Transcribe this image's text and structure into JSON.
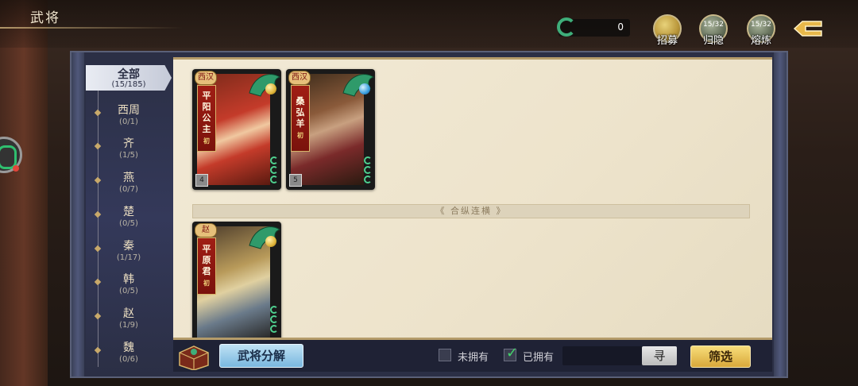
{
  "header": {
    "title": "武将"
  },
  "currency": {
    "value": "0",
    "icon": "jade-ring-icon"
  },
  "top_buttons": [
    {
      "label": "招募",
      "count": "",
      "icon": "recruit-scroll-icon"
    },
    {
      "label": "归隐",
      "count": "15/32",
      "icon": "retire-icon"
    },
    {
      "label": "熔炼",
      "count": "15/32",
      "icon": "smelt-icon"
    }
  ],
  "back_icon": "back-arrow-icon",
  "sidebar": {
    "items": [
      {
        "name": "全部",
        "count": "(15/185)",
        "active": true
      },
      {
        "name": "西周",
        "count": "(0/1)"
      },
      {
        "name": "齐",
        "count": "(1/5)"
      },
      {
        "name": "燕",
        "count": "(0/7)"
      },
      {
        "name": "楚",
        "count": "(0/5)"
      },
      {
        "name": "秦",
        "count": "(1/17)"
      },
      {
        "name": "韩",
        "count": "(0/5)"
      },
      {
        "name": "赵",
        "count": "(1/9)"
      },
      {
        "name": "魏",
        "count": "(0/6)"
      }
    ]
  },
  "divider": {
    "label": "《 合纵连横 》"
  },
  "cards": [
    {
      "state": "西汉",
      "name": [
        "平",
        "阳",
        "公",
        "主"
      ],
      "level": "初",
      "tier": "4",
      "gem_color": "#e0b43a",
      "art_colors": [
        "#c43b2a",
        "#f0c8a0",
        "#7a2a1a"
      ]
    },
    {
      "state": "西汉",
      "name": [
        "桑",
        "弘",
        "羊"
      ],
      "level": "初",
      "tier": "5",
      "gem_color": "#3aa0e0",
      "art_colors": [
        "#8a5a3a",
        "#c8a080",
        "#3a2a1a"
      ]
    },
    {
      "state": "赵",
      "name": [
        "平",
        "原",
        "君"
      ],
      "level": "初",
      "tier": "",
      "gem_color": "#e0b43a",
      "art_colors": [
        "#b89a5a",
        "#e0d0a0",
        "#4a3a2a"
      ]
    }
  ],
  "bottom": {
    "decompose_label": "武将分解",
    "not_owned_label": "未拥有",
    "owned_label": "已拥有",
    "owned_checked": true,
    "not_owned_checked": false,
    "search_button": "寻",
    "filter_button": "筛选"
  }
}
